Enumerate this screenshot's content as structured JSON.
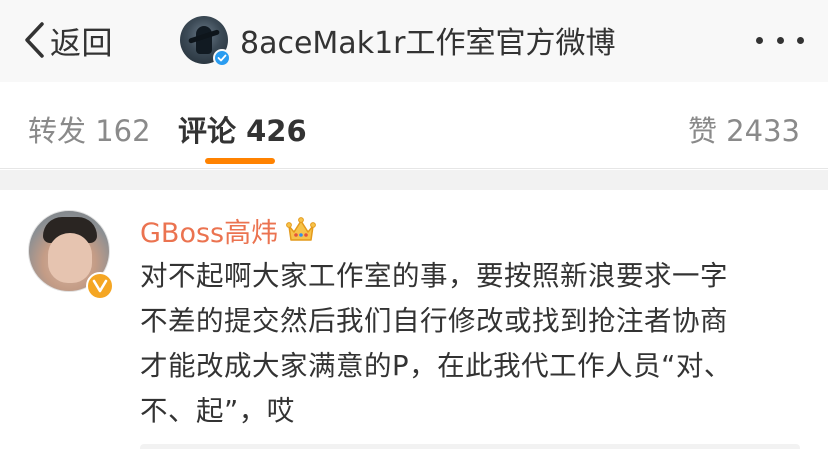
{
  "navbar": {
    "back_label": "返回",
    "account_name": "8aceMak1r工作室官方微博"
  },
  "tabs": [
    {
      "label": "转发 162"
    },
    {
      "label": "评论 426"
    },
    {
      "label": "赞 2433"
    }
  ],
  "active_tab_index": 1,
  "comment": {
    "author": "GBoss高炜",
    "lines": [
      "对不起啊大家工作室的事，要按照新浪要求一字",
      "不差的提交然后我们自行修改或找到抢注者协商",
      "才能改成大家满意的P，在此我代工作人员“对、",
      "不、起”，哎"
    ]
  },
  "colors": {
    "accent": "#ff8200",
    "author_name": "#eb7350",
    "verified_blue": "#2a9cf0",
    "vip_gold": "#f5a623"
  },
  "icons": {
    "back": "chevron-left-icon",
    "more": "more-dots-icon",
    "verified": "verified-check-icon",
    "crown": "crown-icon",
    "vip": "vip-v-icon"
  }
}
